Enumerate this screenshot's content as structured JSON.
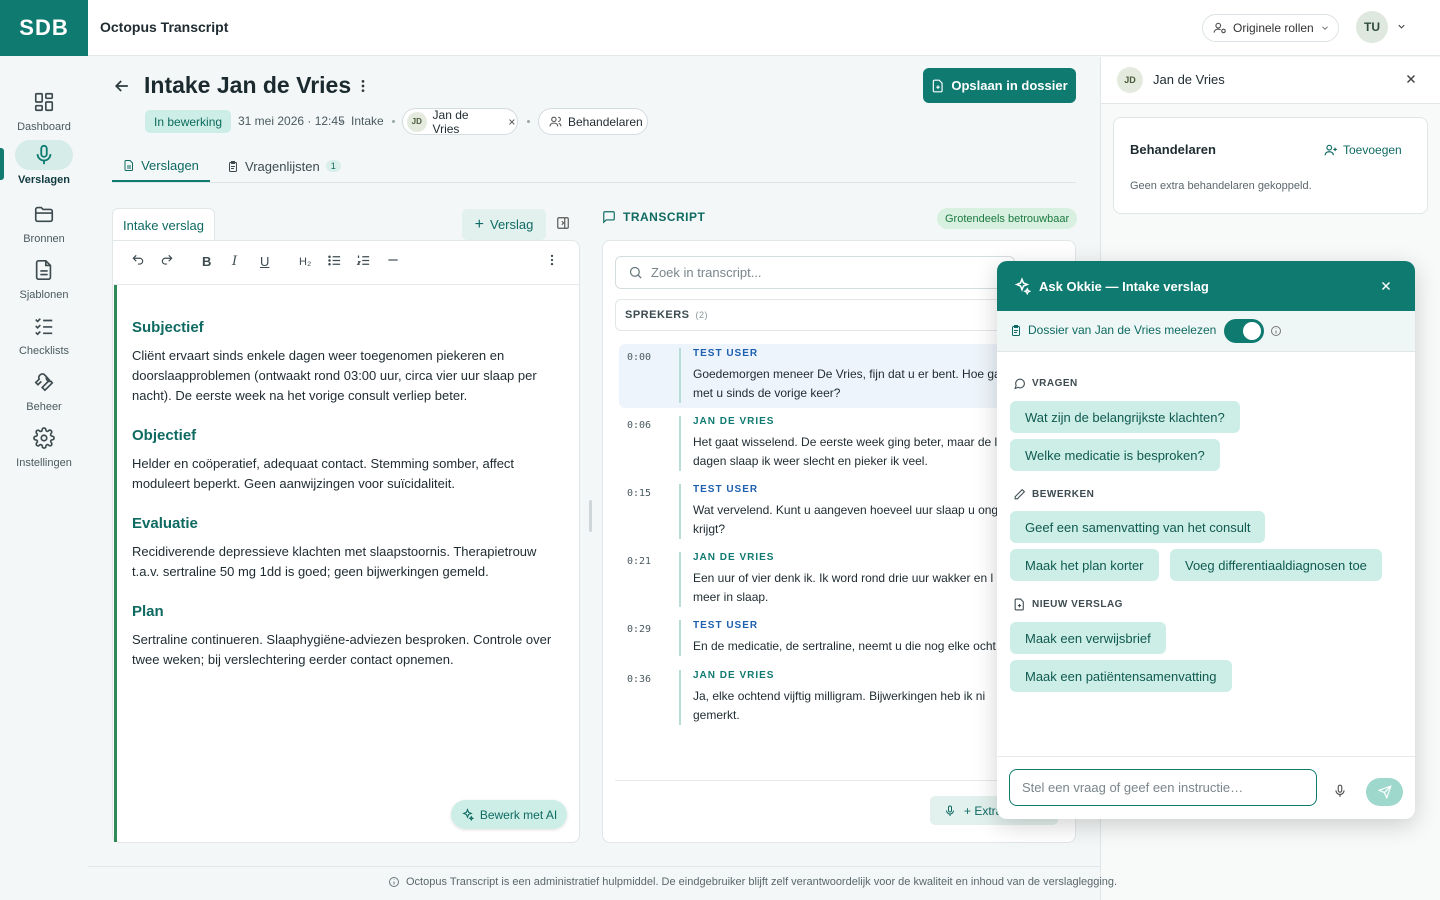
{
  "app": {
    "logo": "SDB",
    "name": "Octopus Transcript"
  },
  "topbar": {
    "roles_label": "Originele rollen",
    "user_initials": "TU"
  },
  "sidebar": {
    "items": [
      {
        "label": "Dashboard",
        "icon": "dashboard-icon"
      },
      {
        "label": "Verslagen",
        "icon": "microphone-icon",
        "active": true
      },
      {
        "label": "Bronnen",
        "icon": "folder-icon"
      },
      {
        "label": "Sjablonen",
        "icon": "document-icon"
      },
      {
        "label": "Checklists",
        "icon": "checklist-icon"
      },
      {
        "label": "Beheer",
        "icon": "wrench-icon"
      },
      {
        "label": "Instellingen",
        "icon": "gear-icon"
      }
    ]
  },
  "header": {
    "title": "Intake Jan de Vries",
    "save_label": "Opslaan in dossier",
    "status": "In bewerking",
    "datetime": "31 mei 2026 · 12:45",
    "type": "Intake",
    "client_initials": "JD",
    "client_name": "Jan de Vries",
    "behandelaren_label": "Behandelaren"
  },
  "tabs": [
    {
      "label": "Verslagen",
      "active": true
    },
    {
      "label": "Vragenlijsten",
      "count": "1"
    }
  ],
  "editor": {
    "tab_label": "Intake verslag",
    "add_label": "Verslag",
    "ai_label": "Bewerk met AI",
    "sections": [
      {
        "heading": "Subjectief",
        "text": "Cliënt ervaart sinds enkele dagen weer toegenomen piekeren en doorslaapproblemen (ontwaakt rond 03:00 uur, circa vier uur slaap per nacht). De eerste week na het vorige consult verliep beter."
      },
      {
        "heading": "Objectief",
        "text": "Helder en coöperatief, adequaat contact. Stemming somber, affect moduleert beperkt. Geen aanwijzingen voor suïcidaliteit."
      },
      {
        "heading": "Evaluatie",
        "text": "Recidiverende depressieve klachten met slaapstoornis. Therapietrouw t.a.v. sertraline 50 mg 1dd is goed; geen bijwerkingen gemeld."
      },
      {
        "heading": "Plan",
        "text": "Sertraline continueren. Slaaphygiëne-adviezen besproken. Controle over twee weken; bij verslechtering eerder contact opnemen."
      }
    ]
  },
  "transcript": {
    "title": "TRANSCRIPT",
    "reliability": "Grotendeels betrouwbaar",
    "search_placeholder": "Zoek in transcript...",
    "speakers_label": "SPREKERS",
    "speakers_count": "(2)",
    "segments": [
      {
        "time": "0:00",
        "speaker": "TEST USER",
        "text": "Goedemorgen meneer De Vries, fijn dat u er bent. Hoe ga met u sinds de vorige keer?"
      },
      {
        "time": "0:06",
        "speaker": "JAN DE VRIES",
        "text": "Het gaat wisselend. De eerste week ging beter, maar de l dagen slaap ik weer slecht en pieker ik veel."
      },
      {
        "time": "0:15",
        "speaker": "TEST USER",
        "text": "Wat vervelend. Kunt u aangeven hoeveel uur slaap u ong krijgt?"
      },
      {
        "time": "0:21",
        "speaker": "JAN DE VRIES",
        "text": "Een uur of vier denk ik. Ik word rond drie uur wakker en l niet meer in slaap."
      },
      {
        "time": "0:29",
        "speaker": "TEST USER",
        "text": "En de medicatie, de sertraline, neemt u die nog elke ocht"
      },
      {
        "time": "0:36",
        "speaker": "JAN DE VRIES",
        "text": "Ja, elke ochtend vijftig milligram. Bijwerkingen heb ik ni gemerkt."
      }
    ],
    "extra_label": "+ Extra"
  },
  "right_panel": {
    "client_initials": "JD",
    "client_name": "Jan de Vries",
    "behandelaren_title": "Behandelaren",
    "add_label": "Toevoegen",
    "empty_text": "Geen extra behandelaren gekoppeld."
  },
  "okkie": {
    "title": "Ask Okkie — Intake verslag",
    "dossier_label": "Dossier van Jan de Vries meelezen",
    "toggle_on": true,
    "groups": {
      "vragen": "VRAGEN",
      "bewerken": "BEWERKEN",
      "nieuw": "NIEUW VERSLAG"
    },
    "chips": {
      "q1": "Wat zijn de belangrijkste klachten?",
      "q2": "Welke medicatie is besproken?",
      "b1": "Geef een samenvatting van het consult",
      "b2": "Maak het plan korter",
      "b3": "Voeg differentiaaldiagnosen toe",
      "n1": "Maak een verwijsbrief",
      "n2": "Maak een patiëntensamenvatting"
    },
    "input_placeholder": "Stel een vraag of geef een instructie…"
  },
  "footer": {
    "disclaimer": "Octopus Transcript is een administratief hulpmiddel. De eindgebruiker blijft zelf verantwoordelijk voor de kwaliteit en inhoud van de verslaglegging."
  },
  "colors": {
    "primary": "#0f7a70",
    "accent_light": "#cdeee6",
    "speaker_user": "#1e5fb0"
  }
}
